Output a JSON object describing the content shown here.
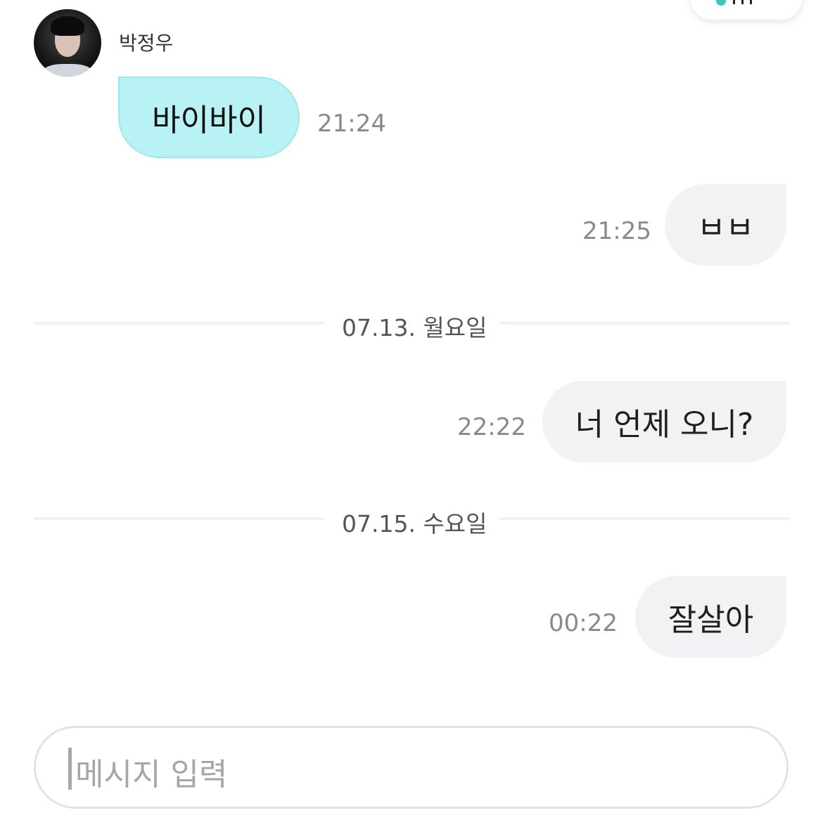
{
  "contact": {
    "name": "박정우"
  },
  "messages": [
    {
      "direction": "incoming",
      "text": "바이바이",
      "time": "21:24"
    },
    {
      "direction": "outgoing",
      "text": "ㅂㅂ",
      "time": "21:25"
    },
    {
      "direction": "outgoing",
      "text": "너 언제 오니?",
      "time": "22:22"
    },
    {
      "direction": "outgoing",
      "text": "잘살아",
      "time": "00:22"
    }
  ],
  "date_dividers": [
    {
      "label": "07.13. 월요일"
    },
    {
      "label": "07.15. 수요일"
    }
  ],
  "composer": {
    "placeholder": "메시지 입력"
  },
  "colors": {
    "incoming_bubble": "#b9f2f4",
    "outgoing_bubble": "#f2f2f5",
    "accent": "#35c9c0"
  }
}
